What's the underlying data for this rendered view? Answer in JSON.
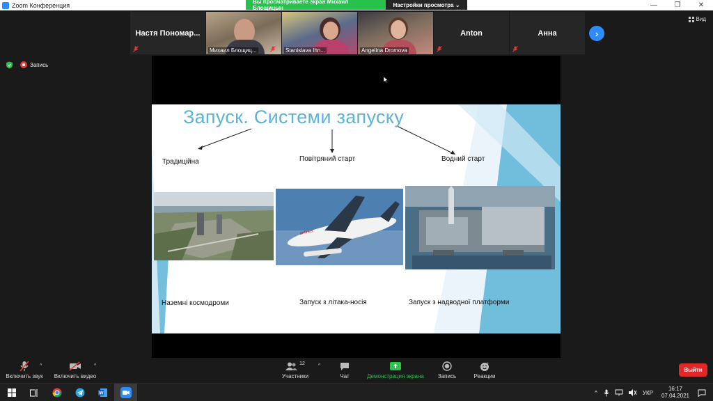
{
  "window": {
    "title": "Zoom Конференция"
  },
  "banner": {
    "viewing": "Вы просматриваете экран Михаил Блощицын",
    "view_options": "Настройки просмотра ⌄"
  },
  "participants": [
    {
      "name": "Настя Пономар...",
      "video": false,
      "muted": true
    },
    {
      "name": "Михаил Блощиц...",
      "video": true,
      "muted": true
    },
    {
      "name": "Stanislava Ihn...",
      "video": true,
      "muted": true
    },
    {
      "name": "Angelina Dromova",
      "video": true,
      "muted": true
    },
    {
      "name": "Anton",
      "video": false,
      "muted": true
    },
    {
      "name": "Анна",
      "video": false,
      "muted": true
    }
  ],
  "view_button": "Вид",
  "record_label": "Запись",
  "slide": {
    "title": "Запуск. Системи запуску",
    "top_labels": [
      "Традиційна",
      "Повітряний старт",
      "Водний старт"
    ],
    "bottom_labels": [
      "Наземні космодроми",
      "Запуск з літака-носія",
      "Запуск з надводної платформи"
    ]
  },
  "toolbar": {
    "mute": "Включить звук",
    "video": "Включить видео",
    "participants": "Участники",
    "participants_count": "12",
    "chat": "Чат",
    "share": "Демонстрация экрана",
    "record": "Запись",
    "reactions": "Реакции",
    "leave": "Выйти"
  },
  "taskbar": {
    "language": "УКР",
    "time": "16:17",
    "date": "07.04.2021"
  },
  "colors": {
    "accent": "#2d8cff",
    "share_green": "#2dc24c",
    "leave_red": "#e02828",
    "slide_title": "#5ab4d6"
  }
}
